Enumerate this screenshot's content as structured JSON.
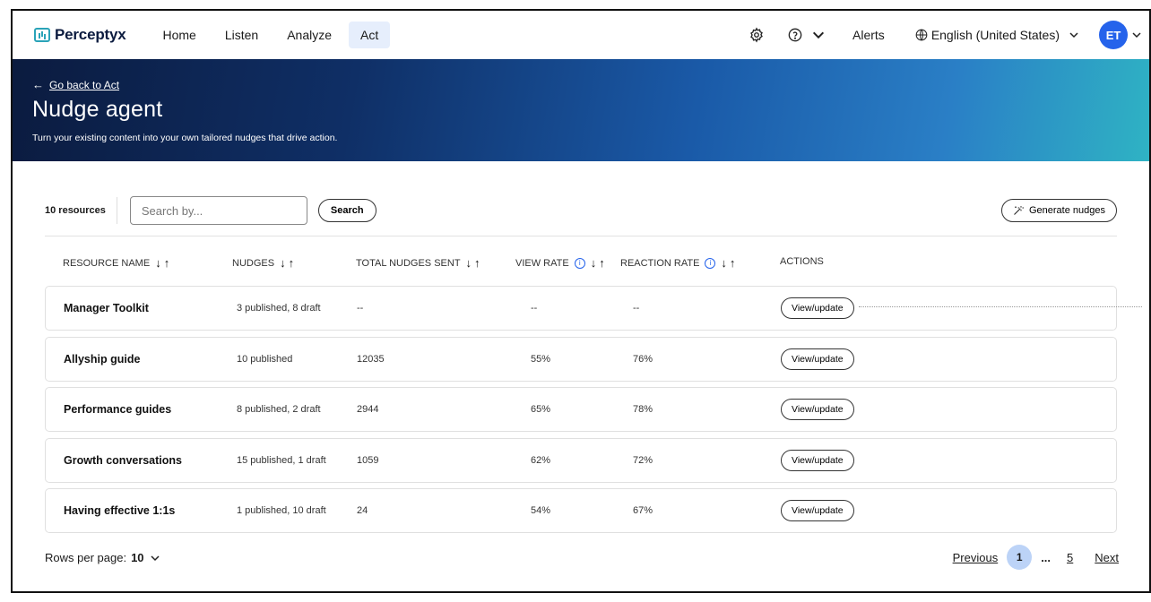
{
  "nav": {
    "brand": "Perceptyx",
    "items": [
      {
        "label": "Home"
      },
      {
        "label": "Listen"
      },
      {
        "label": "Analyze"
      },
      {
        "label": "Act"
      }
    ],
    "alerts": "Alerts",
    "language": "English (United States)",
    "avatar_initials": "ET"
  },
  "hero": {
    "back_link": "Go back to Act",
    "title": "Nudge agent",
    "subtitle": "Turn your existing content into your own tailored nudges that drive action."
  },
  "toolbar": {
    "resource_count": "10 resources",
    "search_placeholder": "Search by...",
    "search_button": "Search",
    "generate_button": "Generate nudges"
  },
  "table": {
    "headers": {
      "resource_name": "RESOURCE NAME",
      "nudges": "NUDGES",
      "total_sent": "TOTAL NUDGES SENT",
      "view_rate": "VIEW RATE",
      "reaction_rate": "REACTION RATE",
      "actions": "ACTIONS"
    },
    "action_label": "View/update",
    "rows": [
      {
        "name": "Manager Toolkit",
        "nudges": "3 published, 8 draft",
        "sent": "--",
        "view": "--",
        "reaction": "--"
      },
      {
        "name": "Allyship guide",
        "nudges": "10 published",
        "sent": "12035",
        "view": "55%",
        "reaction": "76%"
      },
      {
        "name": "Performance guides",
        "nudges": "8 published, 2 draft",
        "sent": "2944",
        "view": "65%",
        "reaction": "78%"
      },
      {
        "name": "Growth conversations",
        "nudges": "15 published, 1 draft",
        "sent": "1059",
        "view": "62%",
        "reaction": "72%"
      },
      {
        "name": "Having effective 1:1s",
        "nudges": "1 published, 10 draft",
        "sent": "24",
        "view": "54%",
        "reaction": "67%"
      }
    ]
  },
  "footer": {
    "rows_per_page_label": "Rows per page:",
    "rows_per_page_value": "10",
    "previous": "Previous",
    "current_page": "1",
    "ellipsis": "...",
    "last_page": "5",
    "next": "Next"
  },
  "colors": {
    "accent": "#2563eb",
    "hero_start": "#0b1b3f",
    "hero_end": "#2fb3c4",
    "active_tab": "#e6eefc",
    "current_page": "#bcd3f7"
  }
}
